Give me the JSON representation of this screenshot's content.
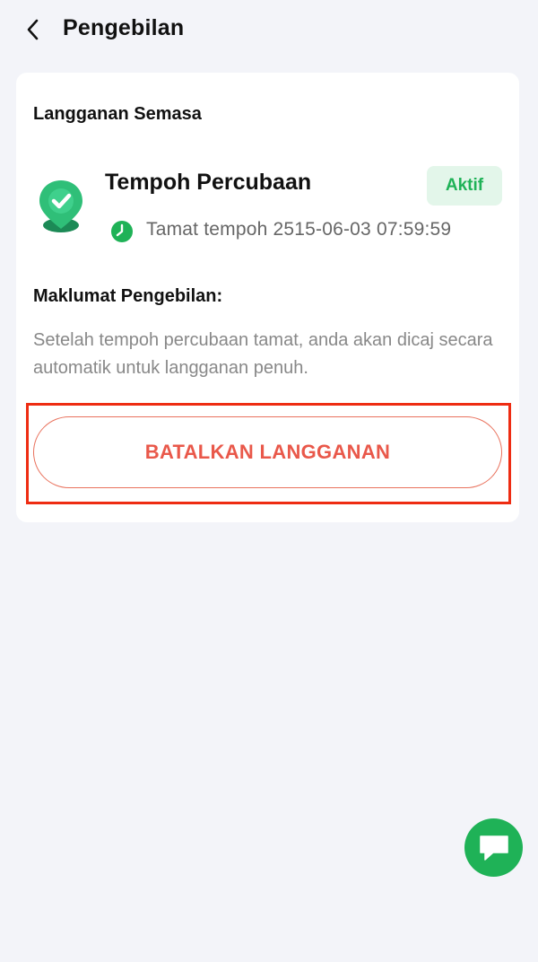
{
  "header": {
    "title": "Pengebilan",
    "back_icon": "chevron-left-icon"
  },
  "subscription": {
    "section_title": "Langganan Semasa",
    "plan_name": "Tempoh Percubaan",
    "plan_icon": "location-check-icon",
    "status": "Aktif",
    "expiry": "Tamat tempoh 2515-06-03 07:59:59",
    "expiry_icon": "clock-icon"
  },
  "billing": {
    "title": "Maklumat Pengebilan:",
    "description": "Setelah tempoh percubaan tamat, anda akan dicaj secara automatik untuk langganan penuh."
  },
  "actions": {
    "cancel_label": "BATALKAN LANGGANAN"
  },
  "fab": {
    "icon": "chat-bubble-icon"
  },
  "colors": {
    "accent_green": "#1fb257",
    "danger": "#e9584a",
    "highlight": "#ee2c12",
    "background": "#f3f4f9"
  }
}
